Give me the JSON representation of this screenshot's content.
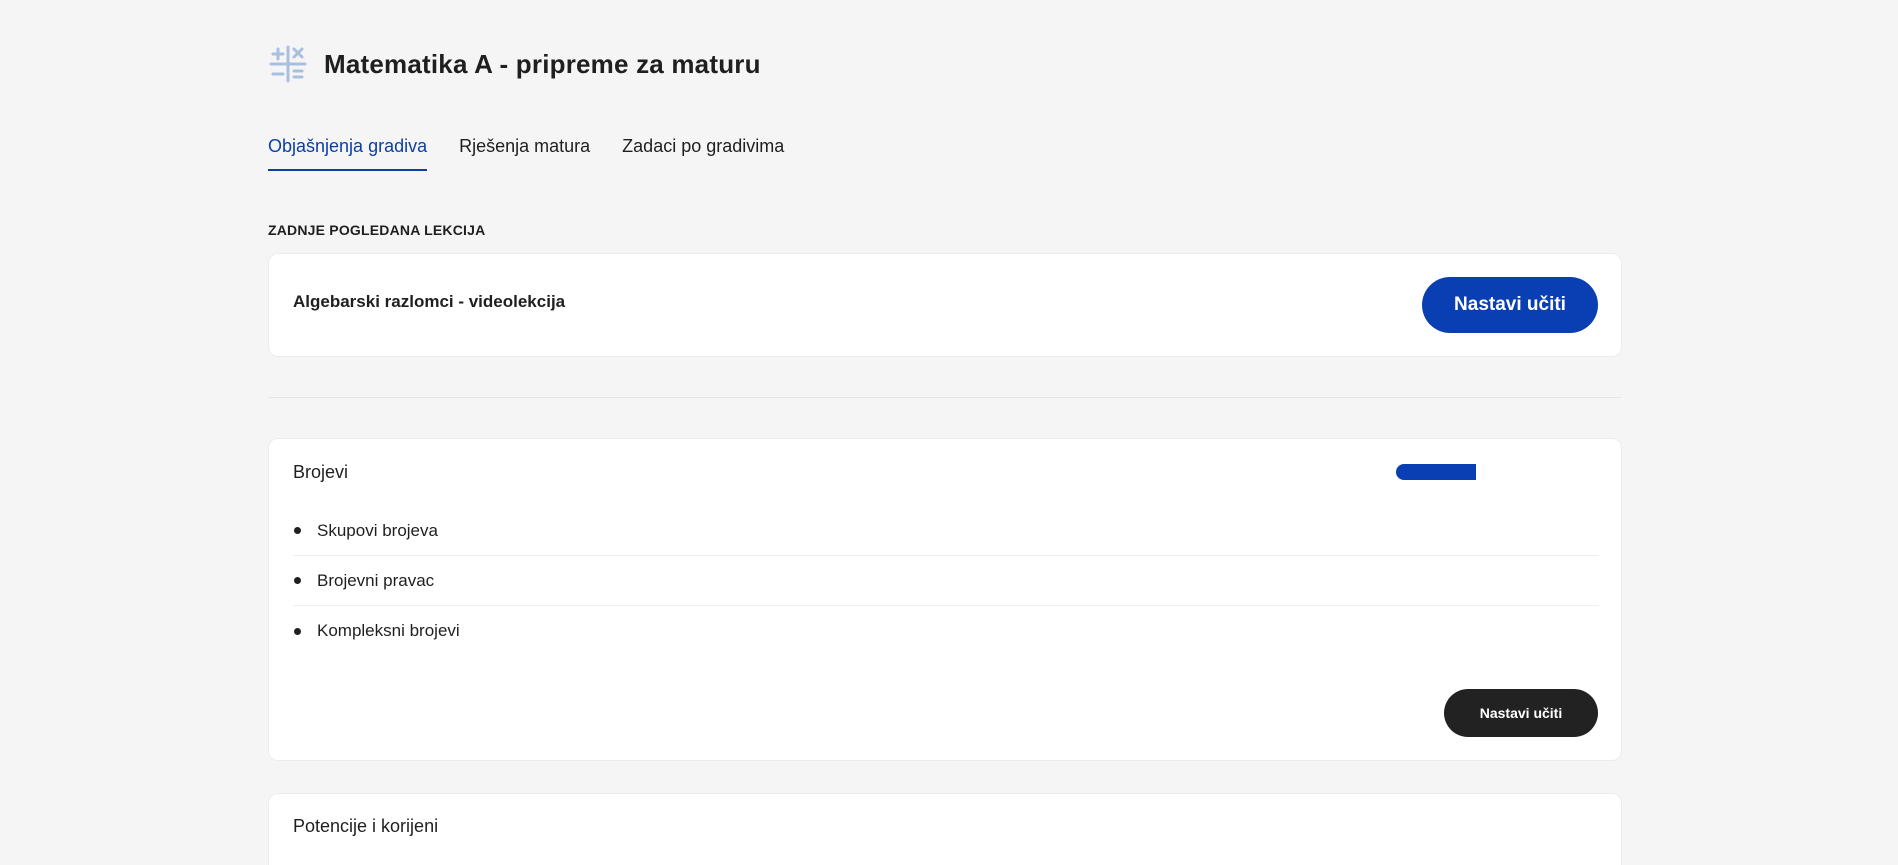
{
  "header": {
    "title": "Matematika A - pripreme za maturu",
    "icon": "math-operators-icon"
  },
  "tabs": [
    {
      "label": "Objašnjenja gradiva",
      "active": true
    },
    {
      "label": "Rješenja matura",
      "active": false
    },
    {
      "label": "Zadaci po gradivima",
      "active": false
    }
  ],
  "last_viewed": {
    "section_label": "ZADNJE POGLEDANA LEKCIJA",
    "lesson": "Algebarski razlomci - videolekcija",
    "button_label": "Nastavi učiti"
  },
  "topics": [
    {
      "title": "Brojevi",
      "progress_fraction": 0.8,
      "lessons": [
        "Skupovi brojeva",
        "Brojevni pravac",
        "Kompleksni brojevi"
      ],
      "button_label": "Nastavi učiti"
    },
    {
      "title": "Potencije i korijeni"
    }
  ],
  "colors": {
    "accent": "#0a3fb3",
    "dark_button": "#222222",
    "background": "#f5f5f5"
  }
}
